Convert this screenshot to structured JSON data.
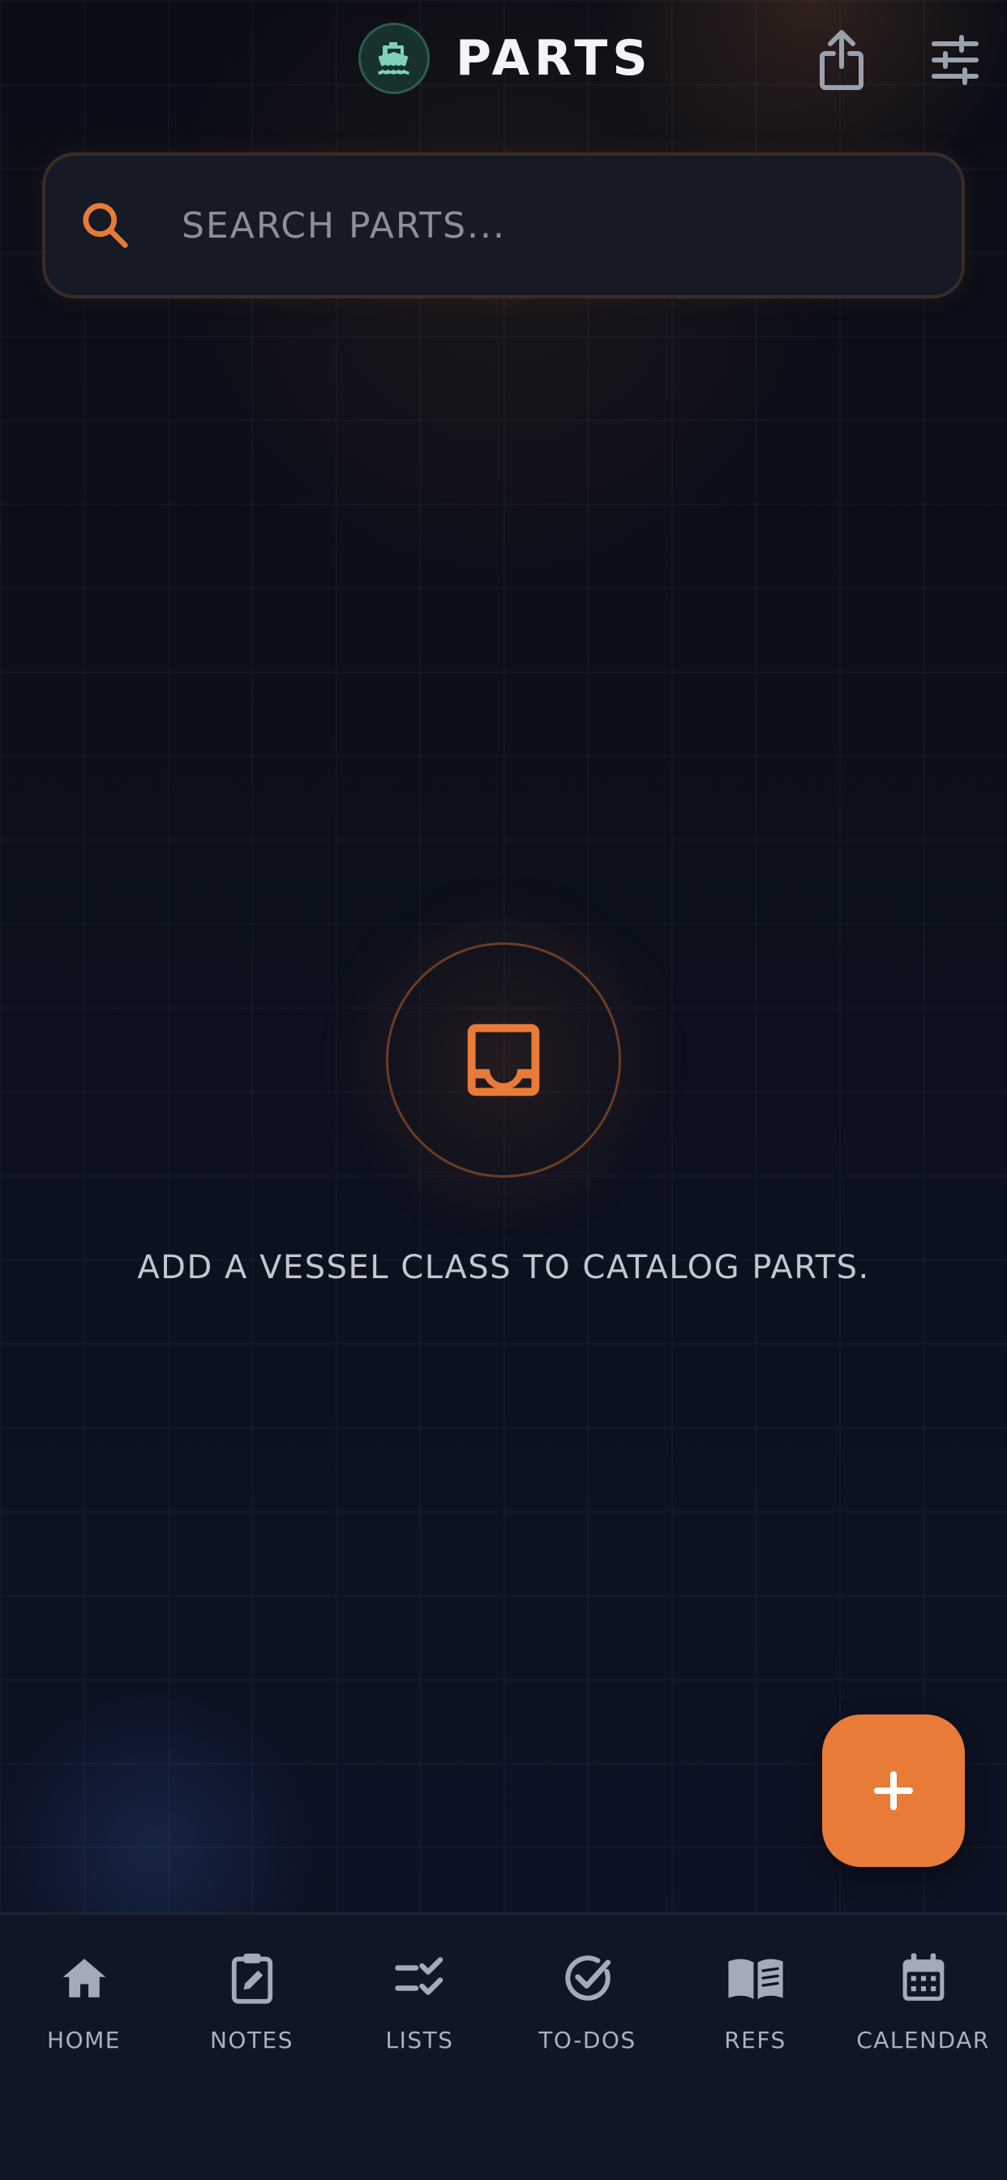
{
  "header": {
    "title": "PARTS",
    "logo_icon": "ship-icon",
    "share_icon": "share-icon",
    "filter_icon": "sliders-icon"
  },
  "search": {
    "placeholder": "SEARCH PARTS...",
    "value": "",
    "icon": "search-icon"
  },
  "empty_state": {
    "icon": "inbox-icon",
    "message": "ADD A VESSEL CLASS TO CATALOG PARTS."
  },
  "fab": {
    "label": "+",
    "icon": "plus-icon"
  },
  "nav": {
    "items": [
      {
        "label": "HOME",
        "icon": "home-icon"
      },
      {
        "label": "NOTES",
        "icon": "clipboard-edit-icon"
      },
      {
        "label": "LISTS",
        "icon": "checklist-icon"
      },
      {
        "label": "TO-DOS",
        "icon": "check-circle-icon"
      },
      {
        "label": "REFS",
        "icon": "book-open-icon"
      },
      {
        "label": "CALENDAR",
        "icon": "calendar-icon"
      }
    ]
  },
  "colors": {
    "accent": "#e87b37",
    "background": "#0b0f19",
    "nav_background": "#101624",
    "logo_badge": "#17312d",
    "logo_icon": "#7fd1b9",
    "text_muted": "#aab0bd"
  }
}
